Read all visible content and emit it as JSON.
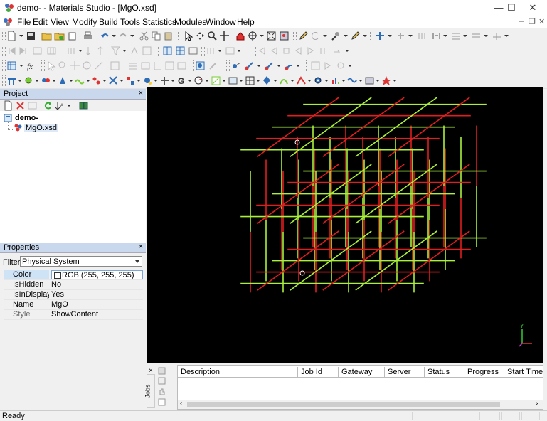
{
  "window": {
    "title": "demo- - Materials Studio - [MgO.xsd]",
    "minimize": "—",
    "maximize": "☐",
    "close": "✕"
  },
  "mdi": {
    "minimize": "–",
    "restore": "❐",
    "close": "✕"
  },
  "menu": [
    "File",
    "Edit",
    "View",
    "Modify",
    "Build",
    "Tools",
    "Statistics",
    "Modules",
    "Window",
    "Help"
  ],
  "project": {
    "title": "Project",
    "close": "×",
    "root": "demo-",
    "file": "MgO.xsd"
  },
  "properties": {
    "title": "Properties",
    "close": "×",
    "filter_label": "Filter:",
    "filter_value": "Physical System",
    "rows": [
      {
        "name": "Color",
        "value": "RGB (255, 255, 255)",
        "selected": true,
        "swatch": "#ffffff"
      },
      {
        "name": "IsHidden",
        "value": "No",
        "selected": false
      },
      {
        "name": "IsInDisplayRange",
        "value": "Yes",
        "selected": false
      },
      {
        "name": "Name",
        "value": "MgO",
        "selected": false
      },
      {
        "name": "Style",
        "value": "ShowContent",
        "selected": false
      }
    ]
  },
  "jobs": {
    "tab": "Jobs",
    "columns": [
      "Description",
      "Job Id",
      "Gateway",
      "Server",
      "Status",
      "Progress",
      "Start Time"
    ]
  },
  "viewer": {
    "axis_y": "Y",
    "lattice_colors": {
      "green": "#a9f03c",
      "red": "#e01e1e"
    }
  },
  "status": {
    "text": "Ready"
  },
  "colors": {
    "panel_header": "#c9d8ec",
    "selection": "#cfe3f7",
    "accent_blue": "#2e6db5"
  }
}
